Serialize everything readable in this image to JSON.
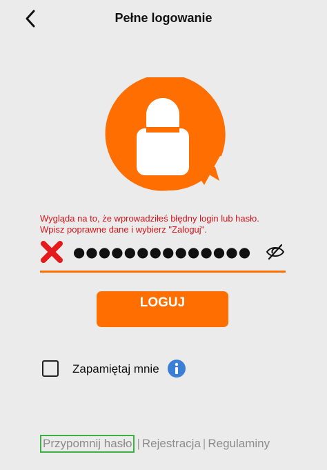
{
  "header": {
    "title": "Pełne logowanie",
    "back_icon": "chevron-left-icon"
  },
  "logo": {
    "icon": "user-avatar-icon",
    "color": "#ff6e00"
  },
  "error": {
    "line1": "Wygląda na to, że wprowadziłeś błędny login lub hasło.",
    "line2": "Wpisz poprawne dane i wybierz \"Zaloguj\".",
    "color": "#d2141a"
  },
  "password": {
    "value": "●●●●●●●●●●●●●●",
    "error_icon": "x-icon",
    "toggle_icon": "eye-off-icon"
  },
  "login_button": {
    "label": "LOGUJ",
    "color": "#ff6e00"
  },
  "remember": {
    "label": "Zapamiętaj mnie",
    "checked": false,
    "info_icon": "info-icon",
    "info_color": "#3a7fd5"
  },
  "footer": {
    "remind": "Przypomnij hasło",
    "separator": "|",
    "register": "Rejestracja",
    "rules": "Regulaminy"
  }
}
